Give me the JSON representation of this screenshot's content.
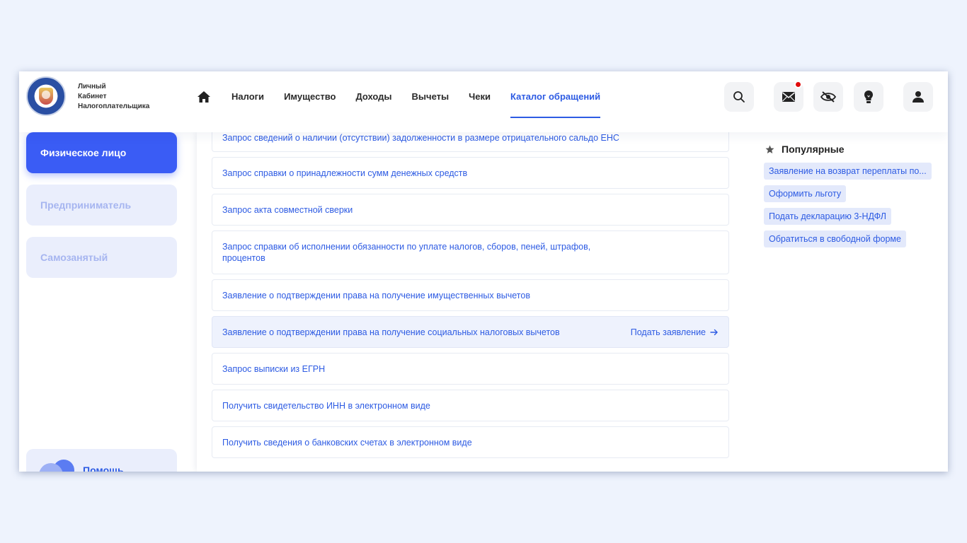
{
  "brand": {
    "line1": "Личный",
    "line2": "Кабинет",
    "line3": "Налогоплательщика"
  },
  "nav": {
    "items": [
      {
        "label": "Налоги"
      },
      {
        "label": "Имущество"
      },
      {
        "label": "Доходы"
      },
      {
        "label": "Вычеты"
      },
      {
        "label": "Чеки"
      },
      {
        "label": "Каталог обращений"
      }
    ],
    "active_index": 5
  },
  "sidebar": {
    "items": [
      {
        "label": "Физическое лицо"
      },
      {
        "label": "Предприниматель"
      },
      {
        "label": "Самозанятый"
      }
    ],
    "help_label": "Помощь"
  },
  "list": {
    "items": [
      {
        "text": "Запрос сведений о наличии (отсутствии) задолженности в размере отрицательного сальдо ЕНС"
      },
      {
        "text": "Запрос справки о принадлежности сумм денежных средств"
      },
      {
        "text": "Запрос акта совместной сверки"
      },
      {
        "text": "Запрос справки об исполнении обязанности по уплате налогов, сборов, пеней, штрафов, процентов"
      },
      {
        "text": "Заявление о подтверждении права на получение имущественных вычетов"
      },
      {
        "text": "Заявление о подтверждении права на получение социальных налоговых вычетов"
      },
      {
        "text": "Запрос выписки из ЕГРН"
      },
      {
        "text": "Получить свидетельство ИНН в электронном виде"
      },
      {
        "text": "Получить сведения о банковских счетах в электронном виде"
      }
    ],
    "apply_label": "Подать заявление"
  },
  "popular": {
    "title": "Популярные",
    "tags": [
      {
        "label": "Заявление на возврат переплаты по..."
      },
      {
        "label": "Оформить льготу"
      },
      {
        "label": "Подать декларацию 3-НДФЛ"
      },
      {
        "label": "Обратиться в свободной форме"
      }
    ]
  },
  "colors": {
    "accent": "#2d5be3",
    "sidebar_active": "#3a5cf5",
    "notification": "#e00b0b"
  }
}
